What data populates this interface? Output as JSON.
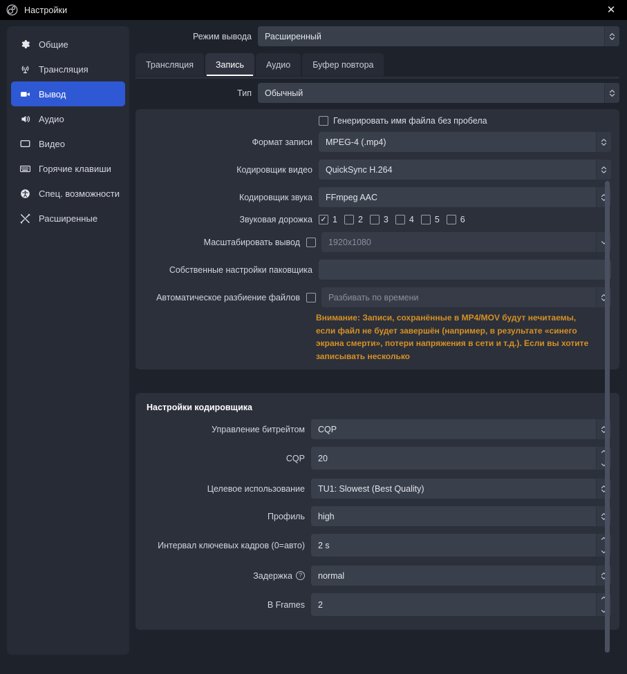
{
  "window": {
    "title": "Настройки",
    "close_label": "✕",
    "app_icon": "obs-logo-icon"
  },
  "sidebar": {
    "items": [
      {
        "label": "Общие",
        "icon": "gear-icon",
        "active": false
      },
      {
        "label": "Трансляция",
        "icon": "broadcast-icon",
        "active": false
      },
      {
        "label": "Вывод",
        "icon": "output-video-icon",
        "active": true
      },
      {
        "label": "Аудио",
        "icon": "speaker-icon",
        "active": false
      },
      {
        "label": "Видео",
        "icon": "monitor-icon",
        "active": false
      },
      {
        "label": "Горячие клавиши",
        "icon": "keyboard-icon",
        "active": false
      },
      {
        "label": "Спец. возможности",
        "icon": "accessibility-icon",
        "active": false
      },
      {
        "label": "Расширенные",
        "icon": "tools-icon",
        "active": false
      }
    ]
  },
  "output_mode": {
    "label": "Режим вывода",
    "value": "Расширенный"
  },
  "tabs": [
    {
      "label": "Трансляция",
      "active": false
    },
    {
      "label": "Запись",
      "active": true
    },
    {
      "label": "Аудио",
      "active": false
    },
    {
      "label": "Буфер повтора",
      "active": false
    }
  ],
  "type": {
    "label": "Тип",
    "value": "Обычный"
  },
  "recording": {
    "no_space_checkbox": {
      "label": "Генерировать имя файла без пробела",
      "checked": false
    },
    "rows": [
      {
        "label": "Формат записи",
        "value": "MPEG-4 (.mp4)"
      },
      {
        "label": "Кодировщик видео",
        "value": "QuickSync H.264"
      },
      {
        "label": "Кодировщик звука",
        "value": "FFmpeg AAC"
      }
    ],
    "audio_track": {
      "label": "Звуковая дорожка",
      "tracks": [
        {
          "num": "1",
          "checked": true
        },
        {
          "num": "2",
          "checked": false
        },
        {
          "num": "3",
          "checked": false
        },
        {
          "num": "4",
          "checked": false
        },
        {
          "num": "5",
          "checked": false
        },
        {
          "num": "6",
          "checked": false
        }
      ]
    },
    "rescale": {
      "label": "Масштабировать вывод",
      "checked": false,
      "placeholder": "1920x1080"
    },
    "muxer": {
      "label": "Собственные настройки паковщика",
      "value": ""
    },
    "auto_split": {
      "label": "Автоматическое разбиение файлов",
      "checked": false,
      "placeholder": "Разбивать по времени"
    },
    "warning": "Внимание: Записи, сохранённые в MP4/MOV будут нечитаемы, если файл не будет завершён (например, в результате «синего экрана смерти», потери напряжения в сети и т.д.). Если вы хотите записывать несколько",
    "warning_color": "#d79023"
  },
  "encoder": {
    "title": "Настройки кодировщика",
    "rows": [
      {
        "label": "Управление битрейтом",
        "value": "CQP",
        "kind": "combo",
        "help": false
      },
      {
        "label": "CQP",
        "value": "20",
        "kind": "spin",
        "help": false
      },
      {
        "label": "Целевое использование",
        "value": "TU1: Slowest (Best Quality)",
        "kind": "combo",
        "help": false
      },
      {
        "label": "Профиль",
        "value": "high",
        "kind": "combo",
        "help": false
      },
      {
        "label": "Интервал ключевых кадров (0=авто)",
        "value": "2 s",
        "kind": "spin",
        "help": false
      },
      {
        "label": "Задержка",
        "value": "normal",
        "kind": "combo",
        "help": true
      },
      {
        "label": "B Frames",
        "value": "2",
        "kind": "spin",
        "help": false
      }
    ]
  },
  "colors": {
    "accent": "#2f59d4",
    "panel": "#2b303b",
    "field": "#3a3f4c",
    "warning": "#d79023",
    "background": "#1e222b"
  }
}
